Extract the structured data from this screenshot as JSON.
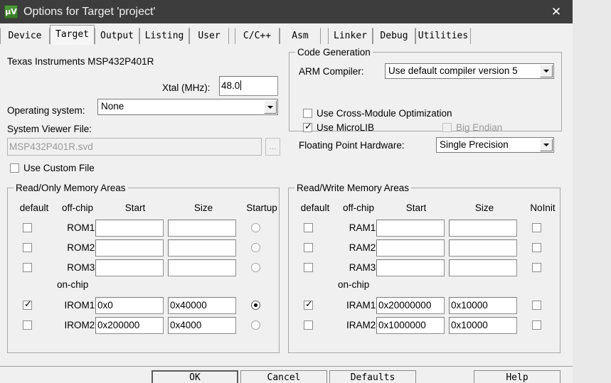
{
  "window": {
    "title": "Options for Target 'project'",
    "icon": "keil-uvision-icon",
    "close_label": "✕"
  },
  "tabs": [
    {
      "label": "Device",
      "active": false
    },
    {
      "label": "Target",
      "active": true
    },
    {
      "label": "Output",
      "active": false
    },
    {
      "label": "Listing",
      "active": false
    },
    {
      "label": "User",
      "active": false
    },
    {
      "label": "C/C++",
      "active": false
    },
    {
      "label": "Asm",
      "active": false
    },
    {
      "label": "Linker",
      "active": false
    },
    {
      "label": "Debug",
      "active": false
    },
    {
      "label": "Utilities",
      "active": false
    }
  ],
  "device": {
    "name": "Texas Instruments MSP432P401R",
    "xtal_label": "Xtal (MHz):",
    "xtal_value": "48.0",
    "os_label": "Operating system:",
    "os_value": "None",
    "svf_label": "System Viewer File:",
    "svf_value": "MSP432P401R.svd",
    "browse_label": "...",
    "custom_file_label": "Use Custom File",
    "custom_file_checked": false
  },
  "code_generation": {
    "title": "Code Generation",
    "compiler_label": "ARM Compiler:",
    "compiler_value": "Use default compiler version 5",
    "cross_module_label": "Use Cross-Module Optimization",
    "cross_module_checked": false,
    "microlib_label": "Use MicroLIB",
    "microlib_checked": true,
    "big_endian_label": "Big Endian",
    "big_endian_checked": false,
    "big_endian_disabled": true,
    "fpu_label": "Floating Point Hardware:",
    "fpu_value": "Single Precision"
  },
  "read_only": {
    "title": "Read/Only Memory Areas",
    "headers": [
      "default",
      "off-chip",
      "Start",
      "Size",
      "Startup"
    ],
    "onchip_label": "on-chip",
    "rows": [
      {
        "name": "ROM1:",
        "checked": false,
        "start": "",
        "size": "",
        "startup": false
      },
      {
        "name": "ROM2:",
        "checked": false,
        "start": "",
        "size": "",
        "startup": false
      },
      {
        "name": "ROM3:",
        "checked": false,
        "start": "",
        "size": "",
        "startup": false
      },
      {
        "name": "IROM1:",
        "checked": true,
        "start": "0x0",
        "size": "0x40000",
        "startup": true
      },
      {
        "name": "IROM2:",
        "checked": false,
        "start": "0x200000",
        "size": "0x4000",
        "startup": false
      }
    ]
  },
  "read_write": {
    "title": "Read/Write Memory Areas",
    "headers": [
      "default",
      "off-chip",
      "Start",
      "Size",
      "NoInit"
    ],
    "onchip_label": "on-chip",
    "rows": [
      {
        "name": "RAM1:",
        "checked": false,
        "start": "",
        "size": "",
        "noinit": false
      },
      {
        "name": "RAM2:",
        "checked": false,
        "start": "",
        "size": "",
        "noinit": false
      },
      {
        "name": "RAM3:",
        "checked": false,
        "start": "",
        "size": "",
        "noinit": false
      },
      {
        "name": "IRAM1:",
        "checked": true,
        "start": "0x20000000",
        "size": "0x10000",
        "noinit": false
      },
      {
        "name": "IRAM2:",
        "checked": false,
        "start": "0x1000000",
        "size": "0x10000",
        "noinit": false
      }
    ]
  },
  "buttons": {
    "ok": "OK",
    "cancel": "Cancel",
    "defaults": "Defaults",
    "help": "Help"
  },
  "colors": {
    "titlebar": "#3d3d3d",
    "dialog_bg": "#f0f0f0",
    "accent_icon": "#4f9c3a",
    "backdrop": "#e9e9e9"
  }
}
